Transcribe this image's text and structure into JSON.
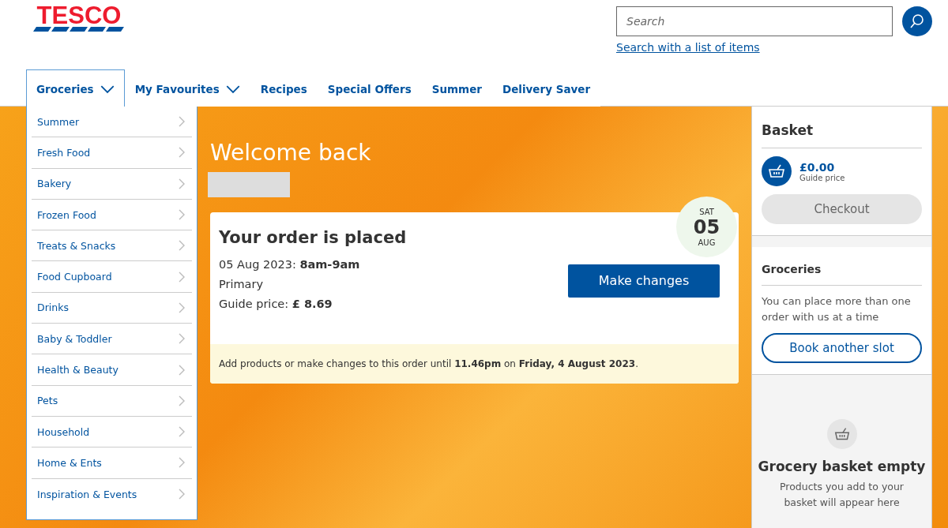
{
  "logo": {
    "text": "TESCO"
  },
  "search": {
    "placeholder": "Search",
    "link": "Search with a list of items"
  },
  "nav": [
    {
      "label": "Groceries",
      "selected": true,
      "dropdown": true
    },
    {
      "label": "My Favourites",
      "selected": false,
      "dropdown": true
    },
    {
      "label": "Recipes",
      "selected": false,
      "dropdown": false
    },
    {
      "label": "Special Offers",
      "selected": false,
      "dropdown": false
    },
    {
      "label": "Summer",
      "selected": false,
      "dropdown": false
    },
    {
      "label": "Delivery Saver",
      "selected": false,
      "dropdown": false
    }
  ],
  "menu": [
    "Summer",
    "Fresh Food",
    "Bakery",
    "Frozen Food",
    "Treats & Snacks",
    "Food Cupboard",
    "Drinks",
    "Baby & Toddler",
    "Health & Beauty",
    "Pets",
    "Household",
    "Home & Ents",
    "Inspiration & Events"
  ],
  "hero": {
    "title": "Welcome back"
  },
  "order": {
    "title": "Your order is placed",
    "slot": "05 Aug 2023: **8am-9am**",
    "address": "Primary",
    "price": "Guide price: **£ 8.69**",
    "button": "Make changes",
    "notice": "Add products or make changes to this order until **11.46pm** on **Friday, 4 August 2023**.",
    "date": {
      "day": "SAT",
      "num": "05",
      "month": "AUG"
    }
  },
  "basket": {
    "title": "Basket",
    "amount": "£0.00",
    "amount_label": "Guide price",
    "checkout": "Checkout",
    "checkout_disabled": true
  },
  "groceries": {
    "title": "Groceries",
    "text": "You can place more than one order with us at a time",
    "button": "Book another slot"
  },
  "empty": {
    "title": "Grocery basket empty",
    "text": "Products you add to your basket will appear here"
  }
}
